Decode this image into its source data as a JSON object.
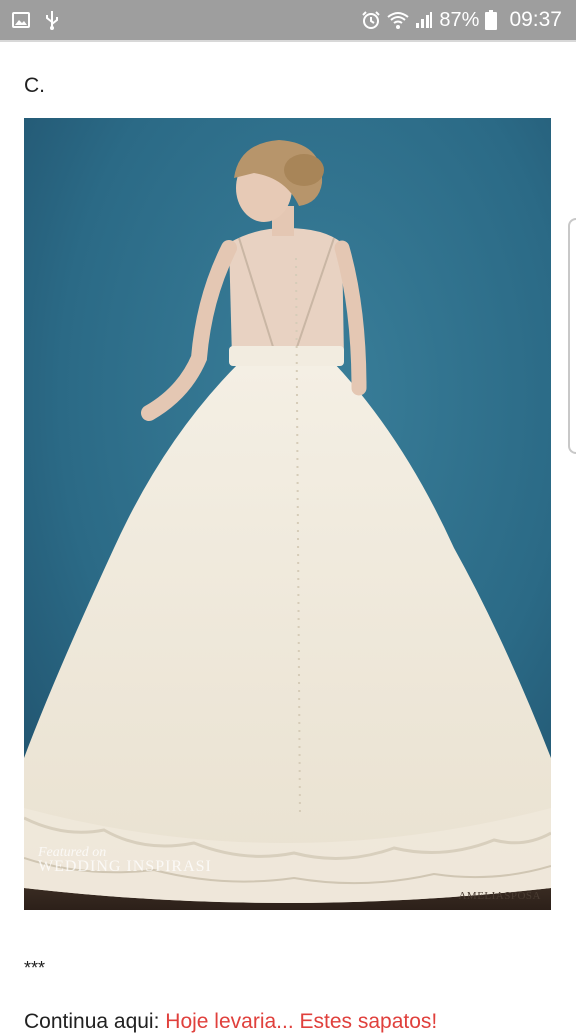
{
  "status_bar": {
    "left_icons": [
      "gallery-icon",
      "usb-icon"
    ],
    "right_icons": [
      "alarm-icon",
      "wifi-icon",
      "signal-icon",
      "battery-icon"
    ],
    "battery_percent": "87%",
    "time": "09:37",
    "colors": {
      "background": "#9e9e9e",
      "foreground": "#ffffff"
    }
  },
  "post": {
    "option_label": "C.",
    "photo": {
      "subject": "bride in white ball-gown wedding dress, back view, against teal-blue backdrop",
      "watermark_brand": "AMELIASPOSA",
      "watermark_site_small": "Featured on",
      "watermark_site_large": "WEDDING INSPIRASI"
    },
    "separator": "***",
    "continue_prefix": "Continua aqui:",
    "links": [
      "Hoje levaria...",
      "Estes sapatos!"
    ]
  },
  "colors": {
    "link": "#e0403c",
    "text": "#212121"
  }
}
